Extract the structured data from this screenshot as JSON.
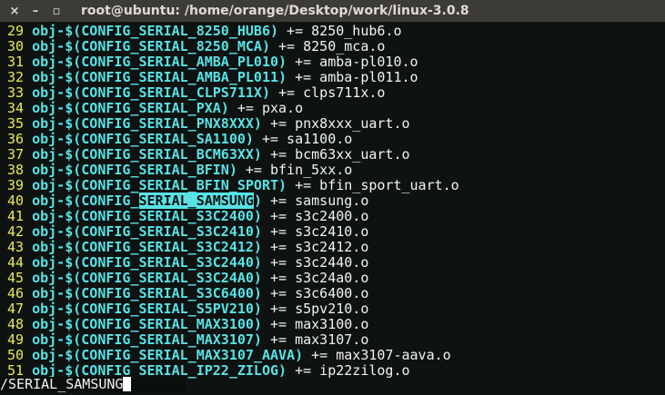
{
  "window": {
    "title": "root@ubuntu: /home/orange/Desktop/work/linux-3.0.8",
    "close_icon": "×",
    "minimize_icon": "–",
    "maximize_icon": "▫"
  },
  "colors": {
    "line_number": "#e8e85a",
    "keyword": "#58e2e6",
    "text": "#f2f2f2",
    "match_highlight": "#58e2e6"
  },
  "lines": [
    {
      "n": "29",
      "code": "obj-$(CONFIG_SERIAL_8250_HUB6)",
      "rest": " += 8250_hub6.o"
    },
    {
      "n": "30",
      "code": "obj-$(CONFIG_SERIAL_8250_MCA)",
      "rest": " += 8250_mca.o"
    },
    {
      "n": "31",
      "code": "obj-$(CONFIG_SERIAL_AMBA_PL010)",
      "rest": " += amba-pl010.o"
    },
    {
      "n": "32",
      "code": "obj-$(CONFIG_SERIAL_AMBA_PL011)",
      "rest": " += amba-pl011.o"
    },
    {
      "n": "33",
      "code": "obj-$(CONFIG_SERIAL_CLPS711X)",
      "rest": " += clps711x.o"
    },
    {
      "n": "34",
      "code": "obj-$(CONFIG_SERIAL_PXA)",
      "rest": " += pxa.o"
    },
    {
      "n": "35",
      "code": "obj-$(CONFIG_SERIAL_PNX8XXX)",
      "rest": " += pnx8xxx_uart.o"
    },
    {
      "n": "36",
      "code": "obj-$(CONFIG_SERIAL_SA1100)",
      "rest": " += sa1100.o"
    },
    {
      "n": "37",
      "code": "obj-$(CONFIG_SERIAL_BCM63XX)",
      "rest": " += bcm63xx_uart.o"
    },
    {
      "n": "38",
      "code": "obj-$(CONFIG_SERIAL_BFIN)",
      "rest": " += bfin_5xx.o"
    },
    {
      "n": "39",
      "code": "obj-$(CONFIG_SERIAL_BFIN_SPORT)",
      "rest": " += bfin_sport_uart.o"
    },
    {
      "n": "40",
      "code_pre": "obj-$(CONFIG_",
      "match": "SERIAL_SAMSUNG",
      "code_post": ")",
      "rest": " += samsung.o"
    },
    {
      "n": "41",
      "code": "obj-$(CONFIG_SERIAL_S3C2400)",
      "rest": " += s3c2400.o"
    },
    {
      "n": "42",
      "code": "obj-$(CONFIG_SERIAL_S3C2410)",
      "rest": " += s3c2410.o"
    },
    {
      "n": "43",
      "code": "obj-$(CONFIG_SERIAL_S3C2412)",
      "rest": " += s3c2412.o"
    },
    {
      "n": "44",
      "code": "obj-$(CONFIG_SERIAL_S3C2440)",
      "rest": " += s3c2440.o"
    },
    {
      "n": "45",
      "code": "obj-$(CONFIG_SERIAL_S3C24A0)",
      "rest": " += s3c24a0.o"
    },
    {
      "n": "46",
      "code": "obj-$(CONFIG_SERIAL_S3C6400)",
      "rest": " += s3c6400.o"
    },
    {
      "n": "47",
      "code": "obj-$(CONFIG_SERIAL_S5PV210)",
      "rest": " += s5pv210.o"
    },
    {
      "n": "48",
      "code": "obj-$(CONFIG_SERIAL_MAX3100)",
      "rest": " += max3100.o"
    },
    {
      "n": "49",
      "code": "obj-$(CONFIG_SERIAL_MAX3107)",
      "rest": " += max3107.o"
    },
    {
      "n": "50",
      "code": "obj-$(CONFIG_SERIAL_MAX3107_AAVA)",
      "rest": " += max3107-aava.o"
    },
    {
      "n": "51",
      "code": "obj-$(CONFIG_SERIAL_IP22_ZILOG)",
      "rest": " += ip22zilog.o"
    }
  ],
  "command_line": "/SERIAL_SAMSUNG"
}
